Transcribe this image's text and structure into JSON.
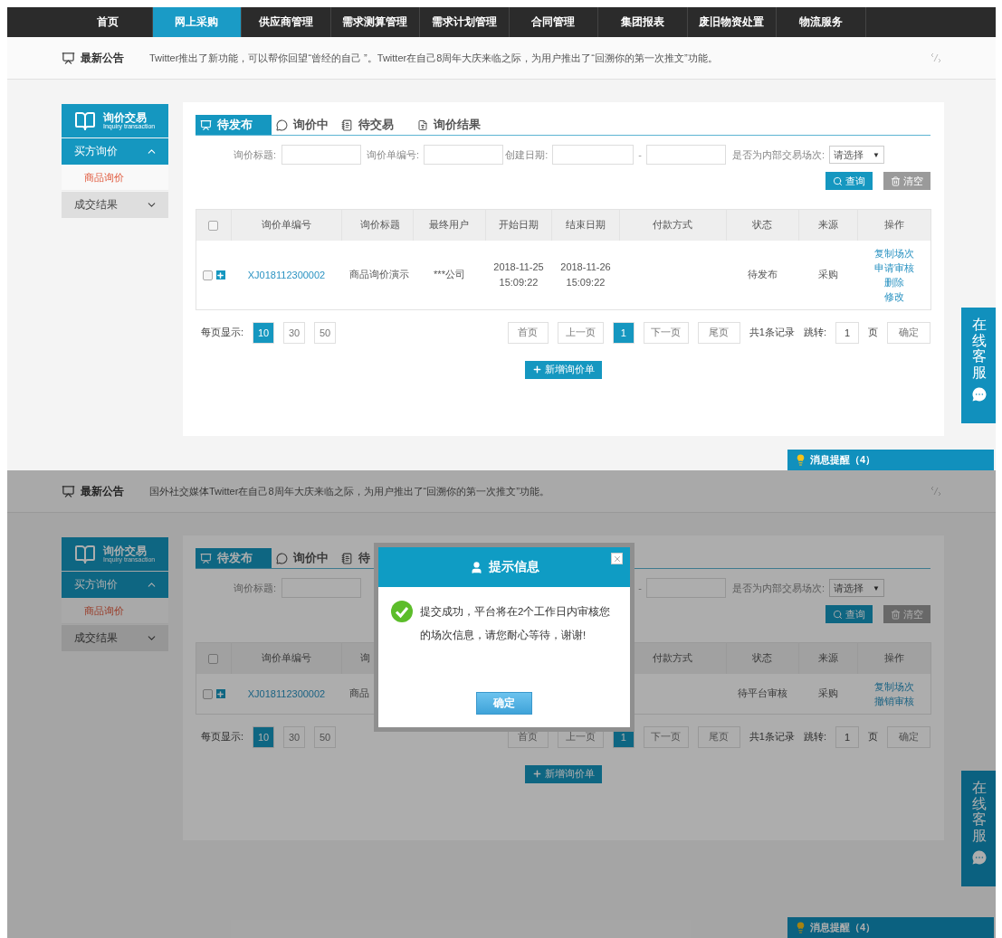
{
  "screens": [
    {
      "nav": [
        {
          "label": "首页",
          "selected": false
        },
        {
          "label": "网上采购",
          "selected": true
        },
        {
          "label": "供应商管理",
          "selected": false
        },
        {
          "label": "需求测算管理",
          "selected": false
        },
        {
          "label": "需求计划管理",
          "selected": false
        },
        {
          "label": "合同管理",
          "selected": false
        },
        {
          "label": "集团报表",
          "selected": false
        },
        {
          "label": "废旧物资处置",
          "selected": false
        },
        {
          "label": "物流服务",
          "selected": false
        }
      ],
      "notice": {
        "title": "最新公告",
        "text": "Twitter推出了新功能，可以帮你回望“曾经的自己 ”。Twitter在自己8周年大庆来临之际，为用户推出了“回溯你的第一次推文”功能。"
      },
      "sidebar": {
        "title": "询价交易",
        "subtitle": "Inquiry transaction",
        "groups": [
          {
            "label": "买方询价",
            "expanded": true,
            "children": [
              {
                "label": "商品询价",
                "selected": true
              }
            ]
          },
          {
            "label": "成交结果",
            "expanded": false
          }
        ]
      },
      "tabs": [
        {
          "label": "待发布",
          "selected": true
        },
        {
          "label": "询价中",
          "selected": false
        },
        {
          "label": "待交易",
          "selected": false
        },
        {
          "label": "询价结果",
          "selected": false
        }
      ],
      "filters": [
        {
          "kind": "text",
          "label": "询价标题:"
        },
        {
          "kind": "text",
          "label": "询价单编号:"
        },
        {
          "kind": "date_range",
          "label": "创建日期:",
          "separator": "-"
        },
        {
          "kind": "select",
          "label": "是否为内部交易场次:",
          "placeholder": "请选择",
          "caret": "▼"
        }
      ],
      "buttons": {
        "query": "查询",
        "clear": "清空"
      },
      "table": {
        "select_all": {
          "checked": false
        },
        "columns": [
          "询价单编号",
          "询价标题",
          "最终用户",
          "开始日期",
          "结束日期",
          "付款方式",
          "状态",
          "来源",
          "操作"
        ],
        "rows": [
          {
            "checked": false,
            "cells": [
              "XJ018112300002",
              "商品询价演示",
              "***公司",
              "2018-11-25 15:09:22",
              "2018-11-26 15:09:22",
              null,
              "待发布",
              "采购"
            ],
            "actions": [
              "复制场次",
              "申请审核",
              "删除",
              "修改"
            ]
          }
        ]
      },
      "pagination": {
        "label": "每页显示:",
        "sizes": [
          {
            "label": "10",
            "selected": true
          },
          {
            "label": "30",
            "selected": false
          },
          {
            "label": "50",
            "selected": false
          }
        ],
        "first": "首页",
        "prev": "上一页",
        "pages": [
          {
            "label": "1",
            "selected": true
          }
        ],
        "next": "下一页",
        "last": "尾页",
        "total": "共1条记录",
        "jump_label": "跳转:",
        "jump_value": "1",
        "page_unit": "页",
        "confirm": "确定"
      },
      "add_button": "新增询价单",
      "service": "在线客服",
      "message": "消息提醒（4）"
    },
    {
      "notice": {
        "title": "最新公告",
        "text": "国外社交媒体Twitter在自己8周年大庆来临之际，为用户推出了“回溯你的第一次推文”功能。"
      },
      "sidebar": {
        "title": "询价交易",
        "subtitle": "Inquiry transaction",
        "groups": [
          {
            "label": "买方询价",
            "expanded": true,
            "children": [
              {
                "label": "商品询价",
                "selected": true
              }
            ]
          },
          {
            "label": "成交结果",
            "expanded": false
          }
        ]
      },
      "tabs": [
        {
          "label": "待发布",
          "selected": true
        },
        {
          "label": "询价中",
          "selected": false
        },
        {
          "label": "待",
          "selected": false
        }
      ],
      "filters": [
        {
          "kind": "text",
          "label": "询价标题:"
        },
        {
          "kind": "covered"
        },
        {
          "kind": "date_end",
          "separator": "-"
        },
        {
          "kind": "select",
          "label": "是否为内部交易场次:",
          "placeholder": "请选择",
          "caret": "▼"
        }
      ],
      "buttons": {
        "query": "查询",
        "clear": "清空"
      },
      "table": {
        "select_all": {
          "checked": false
        },
        "columns": [
          "询价单编号",
          "询",
          null,
          null,
          null,
          "付款方式",
          "状态",
          "来源",
          "操作"
        ],
        "rows": [
          {
            "checked": false,
            "cells": [
              "XJ018112300002",
              "商品",
              null,
              null,
              null,
              null,
              "待平台审核",
              "采购"
            ],
            "actions": [
              "复制场次",
              "撤销审核"
            ]
          }
        ]
      },
      "pagination": {
        "label": "每页显示:",
        "sizes": [
          {
            "label": "10",
            "selected": true
          },
          {
            "label": "30",
            "selected": false
          },
          {
            "label": "50",
            "selected": false
          }
        ],
        "first": "首页",
        "prev": "上一页",
        "pages": [
          {
            "label": "1",
            "selected": true
          }
        ],
        "next": "下一页",
        "last": "尾页",
        "total": "共1条记录",
        "jump_label": "跳转:",
        "jump_value": "1",
        "page_unit": "页",
        "confirm": "确定"
      },
      "add_button": "新增询价单",
      "service": "在线客服",
      "message": "消息提醒（4）",
      "modal": {
        "title": "提示信息",
        "text": "提交成功，平台将在2个工作日内审核您的场次信息，请您耐心等待，谢谢!",
        "button": "确定"
      }
    }
  ]
}
